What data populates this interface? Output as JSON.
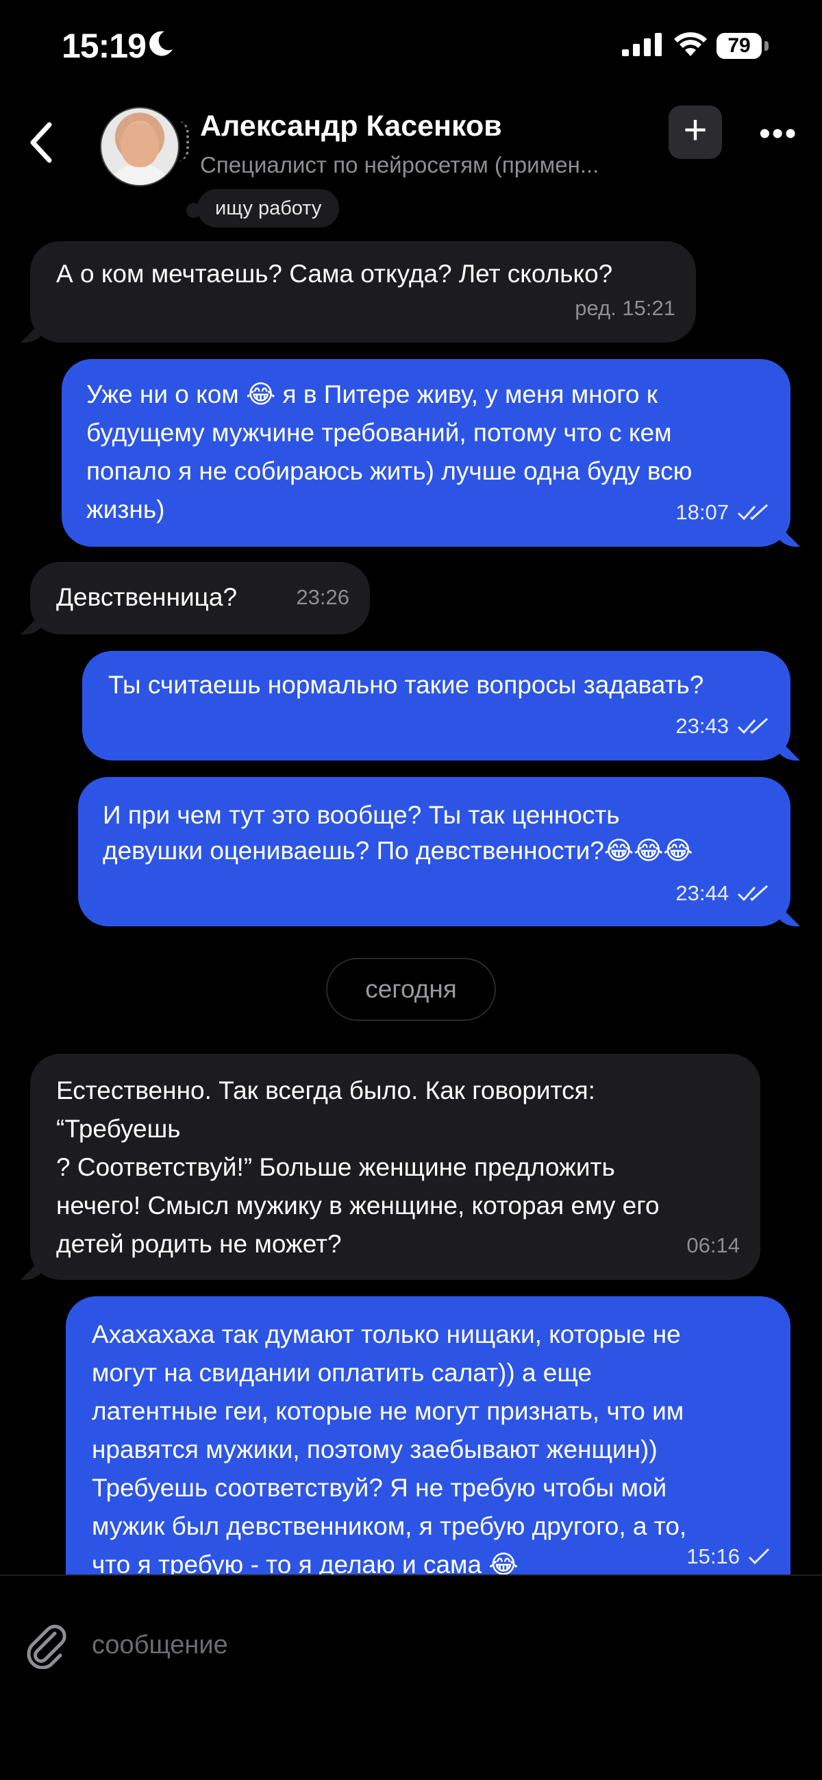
{
  "status_bar": {
    "time": "15:19",
    "battery": "79"
  },
  "header": {
    "name": "Александр Касенков",
    "subtitle": "Специалист по нейросетям (примен...",
    "status_chip": "ищу работу"
  },
  "messages": [
    {
      "dir": "in",
      "text": "А о ком мечтаешь? Сама откуда? Лет сколько?",
      "time": "ред. 15:21"
    },
    {
      "dir": "out",
      "text": "Уже ни о ком 😂 я в Питере живу, у меня много к\nбудущему мужчине требований, потому что с кем\nпопало я не собираюсь жить) лучше одна буду всю\nжизнь)",
      "time": "18:07"
    },
    {
      "dir": "in",
      "text": "Девственница?",
      "time": "23:26"
    },
    {
      "dir": "out",
      "text": "Ты считаешь нормально такие вопросы задавать?",
      "time": "23:43"
    },
    {
      "dir": "out",
      "text": "И при чем тут это вообще? Ты так ценность\nдевушки оцениваешь? По девственности?😂😂😂",
      "time": "23:44"
    },
    {
      "dir": "in",
      "text": "Естественно. Так всегда было. Как говорится:\n“Требуешь\n? Соответствуй!” Больше женщине предложить\nнечего! Смысл мужику в женщине, которая ему его\nдетей родить не может?",
      "time": "06:14"
    },
    {
      "dir": "out",
      "text": "Ахахахаха так думают только нищаки, которые не\nмогут на свидании оплатить салат)) а еще\nлатентные геи, которые не могут признать, что им\nнравятся мужики, поэтому заебывают женщин))\nТребуешь соответствуй? Я не требую чтобы мой\nмужик был девственником, я требую другого, а то,\nчто я требую - то я делаю и сама 😂",
      "time": "15:16"
    }
  ],
  "date_separator": "сегодня",
  "composer": {
    "placeholder": "сообщение"
  },
  "colors": {
    "outgoing": "#2d55e5",
    "incoming": "#1c1c1e",
    "background": "#000000"
  }
}
